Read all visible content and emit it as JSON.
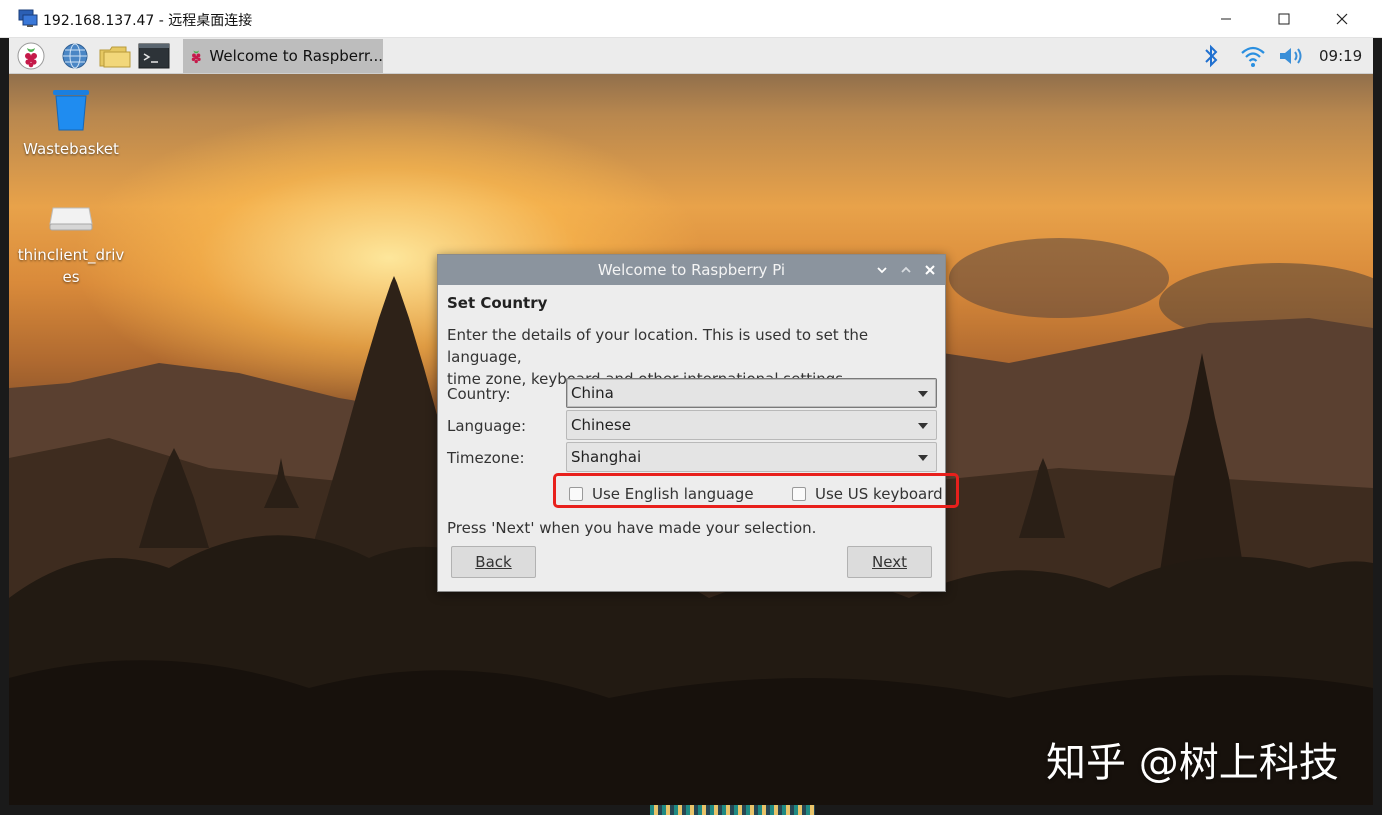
{
  "rdp_window": {
    "title": "192.168.137.47 - 远程桌面连接",
    "icon": "remote-desktop-icon",
    "controls": [
      "minimize-icon",
      "maximize-icon",
      "close-icon"
    ]
  },
  "panel": {
    "launchers": [
      "raspberry-menu-icon",
      "web-browser-icon",
      "file-manager-icon",
      "terminal-icon"
    ],
    "task": {
      "icon": "raspberry-icon",
      "label": "Welcome to Raspberr..."
    },
    "tray": [
      "bluetooth-icon",
      "wifi-icon",
      "volume-icon"
    ],
    "clock": "09:19"
  },
  "desktop_icons": [
    {
      "label": "Wastebasket",
      "icon": "wastebasket-icon"
    },
    {
      "label_line1": "thinclient_driv",
      "label_line2": "es",
      "icon": "drive-icon"
    }
  ],
  "dialog": {
    "title": "Welcome to Raspberry Pi",
    "heading": "Set Country",
    "description_line1": "Enter the details of your location. This is used to set the language,",
    "description_line2": "time zone, keyboard and other international settings.",
    "fields": [
      {
        "label": "Country:",
        "value": "China"
      },
      {
        "label": "Language:",
        "value": "Chinese"
      },
      {
        "label": "Timezone:",
        "value": "Shanghai"
      }
    ],
    "checkboxes": [
      {
        "label": "Use English language",
        "checked": false
      },
      {
        "label": "Use US keyboard",
        "checked": false
      }
    ],
    "note": "Press 'Next' when you have made your selection.",
    "back_label": "Back",
    "next_label": "Next"
  },
  "watermark": "知乎 @树上科技",
  "colors": {
    "dialog_titlebar": "#8b949e",
    "highlight": "#e8201c",
    "panel": "#ececec"
  }
}
